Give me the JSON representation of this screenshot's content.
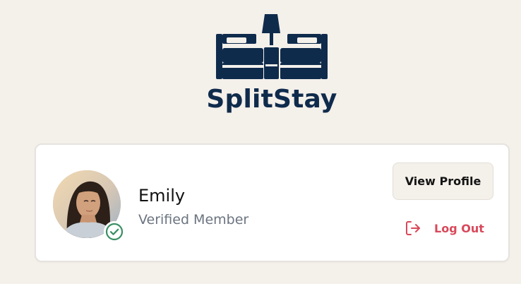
{
  "brand": {
    "name": "SplitStay",
    "color": "#0f2b4c"
  },
  "profile": {
    "name": "Emily",
    "status": "Verified Member",
    "badge_color": "#3a8f63"
  },
  "actions": {
    "view_profile_label": "View Profile",
    "logout_label": "Log Out",
    "logout_color": "#d9485a"
  },
  "icons": {
    "logo": "twin-beds-lamp-logo",
    "verified": "check-circle-icon",
    "logout": "logout-arrow-icon"
  }
}
